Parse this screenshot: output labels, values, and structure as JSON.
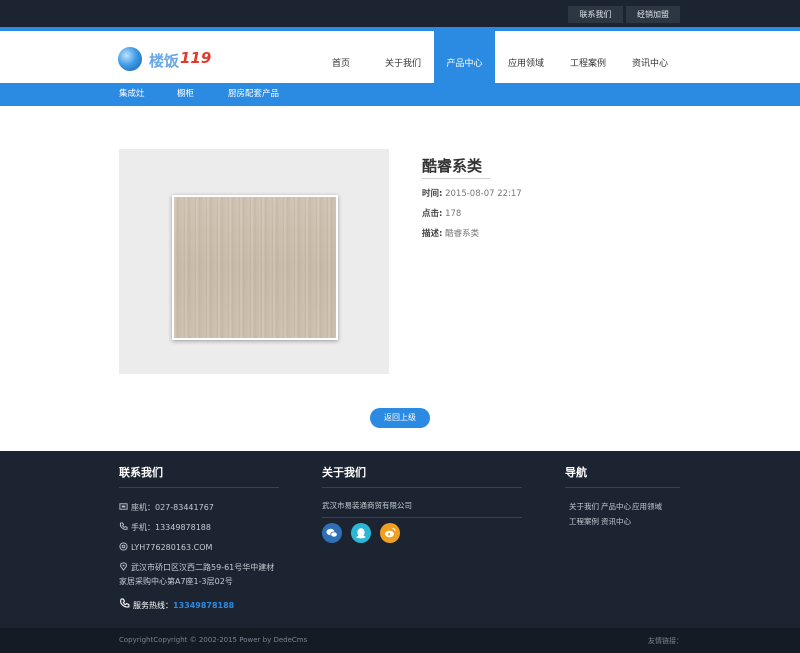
{
  "topbar": {
    "contact_label": "联系我们",
    "dealer_label": "经销加盟"
  },
  "header": {
    "logo_text": "楼饭",
    "logo_number": "119"
  },
  "nav": [
    {
      "label": "首页"
    },
    {
      "label": "关于我们"
    },
    {
      "label": "产品中心",
      "active": true
    },
    {
      "label": "应用领域"
    },
    {
      "label": "工程案例"
    },
    {
      "label": "资讯中心"
    }
  ],
  "subnav": [
    {
      "label": "集成灶"
    },
    {
      "label": "橱柜"
    },
    {
      "label": "厨房配套产品"
    }
  ],
  "product": {
    "title": "酷睿系类",
    "time_label": "时间:",
    "time_value": "2015-08-07 22:17",
    "clicks_label": "点击:",
    "clicks_value": "178",
    "desc_label": "描述:",
    "desc_value": "酷睿系类"
  },
  "back_button": "返回上级",
  "footer": {
    "contact": {
      "heading": "联系我们",
      "phone": "座机：027-83441767",
      "mobile": "手机：13349878188",
      "email": "LYH776280163.COM",
      "address_line1": "武汉市硚口区汉西二路59-61号华中建材",
      "address_line2": "家居采购中心第A7座1-3层02号",
      "hotline_label": "服务热线：",
      "hotline_number": "13349878188"
    },
    "about": {
      "heading": "关于我们",
      "company": "武汉市易装通商贸有限公司"
    },
    "nav": {
      "heading": "导航",
      "links": [
        "关于我们",
        "产品中心",
        "应用领域",
        "工程案例",
        "资讯中心"
      ]
    }
  },
  "bottom": {
    "copyright": "CopyrightCopyright © 2002-2015 Power by DedeCms",
    "friend_links": "友情链接："
  },
  "colors": {
    "accent": "#2b8ae2",
    "dark": "#1b2430",
    "wechat": "#2f6fb5",
    "qq": "#2cb6d6",
    "weibo": "#f0a020"
  },
  "icons": [
    "wechat-icon",
    "qq-icon",
    "weibo-icon",
    "phone-icon",
    "mobile-icon",
    "email-icon",
    "location-icon",
    "hotline-icon"
  ]
}
